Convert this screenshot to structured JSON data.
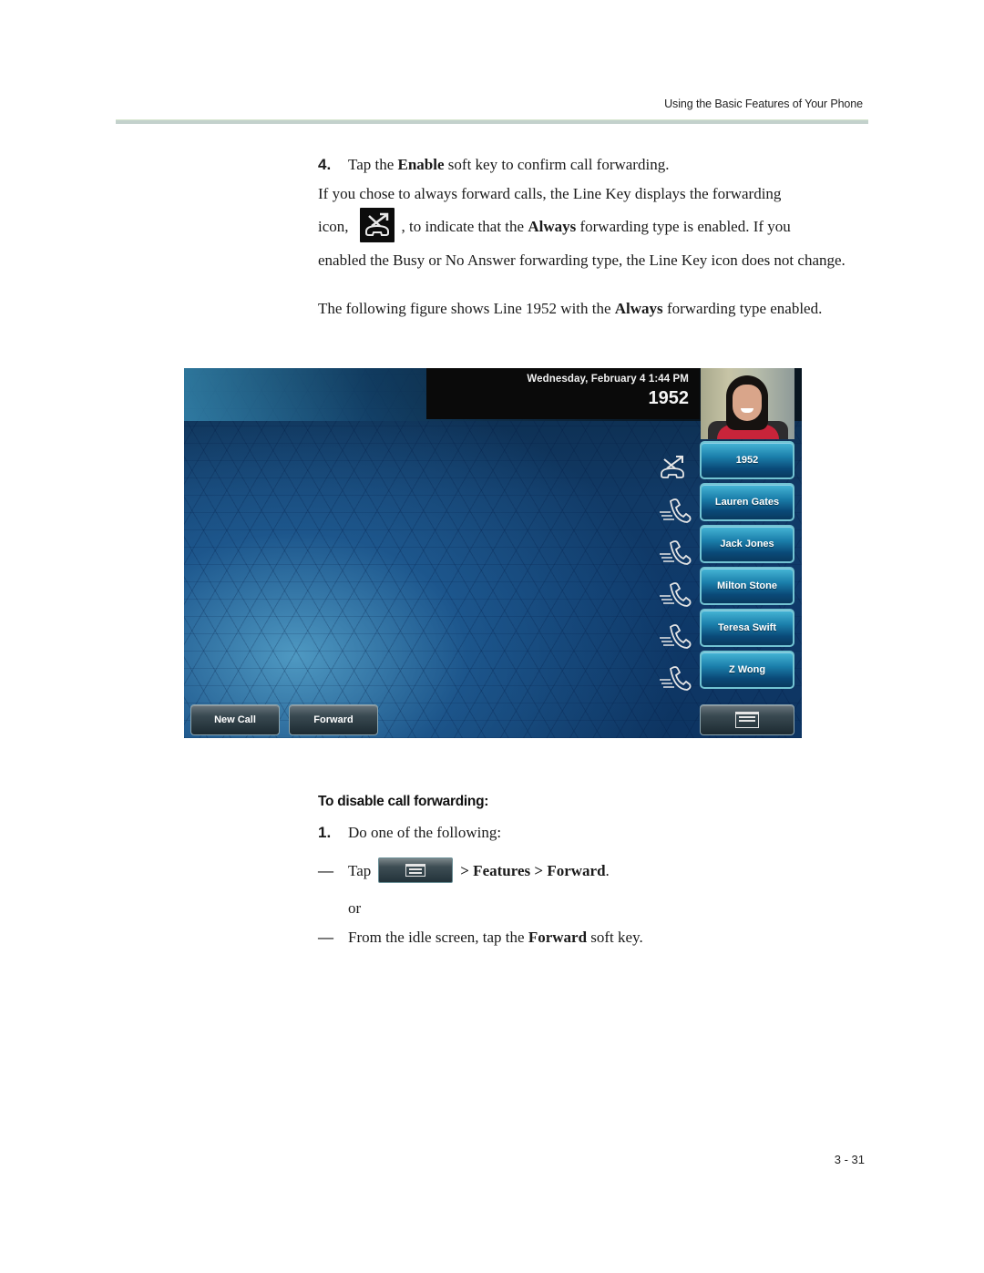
{
  "header": {
    "running_title": "Using the Basic Features of Your Phone"
  },
  "step4": {
    "number": "4.",
    "text_before": "Tap the ",
    "bold": "Enable",
    "text_after": " soft key to confirm call forwarding."
  },
  "para1": {
    "line1": "If you chose to always forward calls, the Line Key displays the forwarding",
    "icon_prefix": "icon,",
    "icon_name": "call-forward-always-icon",
    "after_icon_1": ", to indicate that the ",
    "after_icon_bold": "Always",
    "after_icon_2": " forwarding type is enabled. If you",
    "rest": "enabled the Busy or No Answer forwarding type, the Line Key icon does not change."
  },
  "para2": {
    "before": "The following figure shows Line 1952 with the ",
    "bold": "Always",
    "after": " forwarding type enabled."
  },
  "phone_screen": {
    "datetime": "Wednesday, February 4  1:44 PM",
    "line_number": "1952",
    "contact_photo": "contact-photo",
    "line_keys": [
      {
        "label": "1952",
        "icon": "call-forward-always-icon"
      },
      {
        "label": "Lauren Gates",
        "icon": "speed-dial-handset-icon"
      },
      {
        "label": "Jack Jones",
        "icon": "speed-dial-handset-icon"
      },
      {
        "label": "Milton Stone",
        "icon": "speed-dial-handset-icon"
      },
      {
        "label": "Teresa Swift",
        "icon": "speed-dial-handset-icon"
      },
      {
        "label": "Z Wong",
        "icon": "speed-dial-handset-icon"
      }
    ],
    "softkeys": {
      "new_call": "New Call",
      "forward": "Forward",
      "menu_icon": "menu-icon"
    }
  },
  "section": {
    "heading": "To disable call forwarding:",
    "step1_number": "1.",
    "step1_text": "Do one of the following:",
    "option1_dash": "—",
    "option1_tap": "Tap",
    "option1_after": "> Features > Forward",
    "option1_period": ".",
    "or_text": "or",
    "option2_dash": "—",
    "option2_before": "From the idle screen, tap the ",
    "option2_bold": "Forward",
    "option2_after": " soft key."
  },
  "footer": {
    "page_number": "3 - 31"
  }
}
